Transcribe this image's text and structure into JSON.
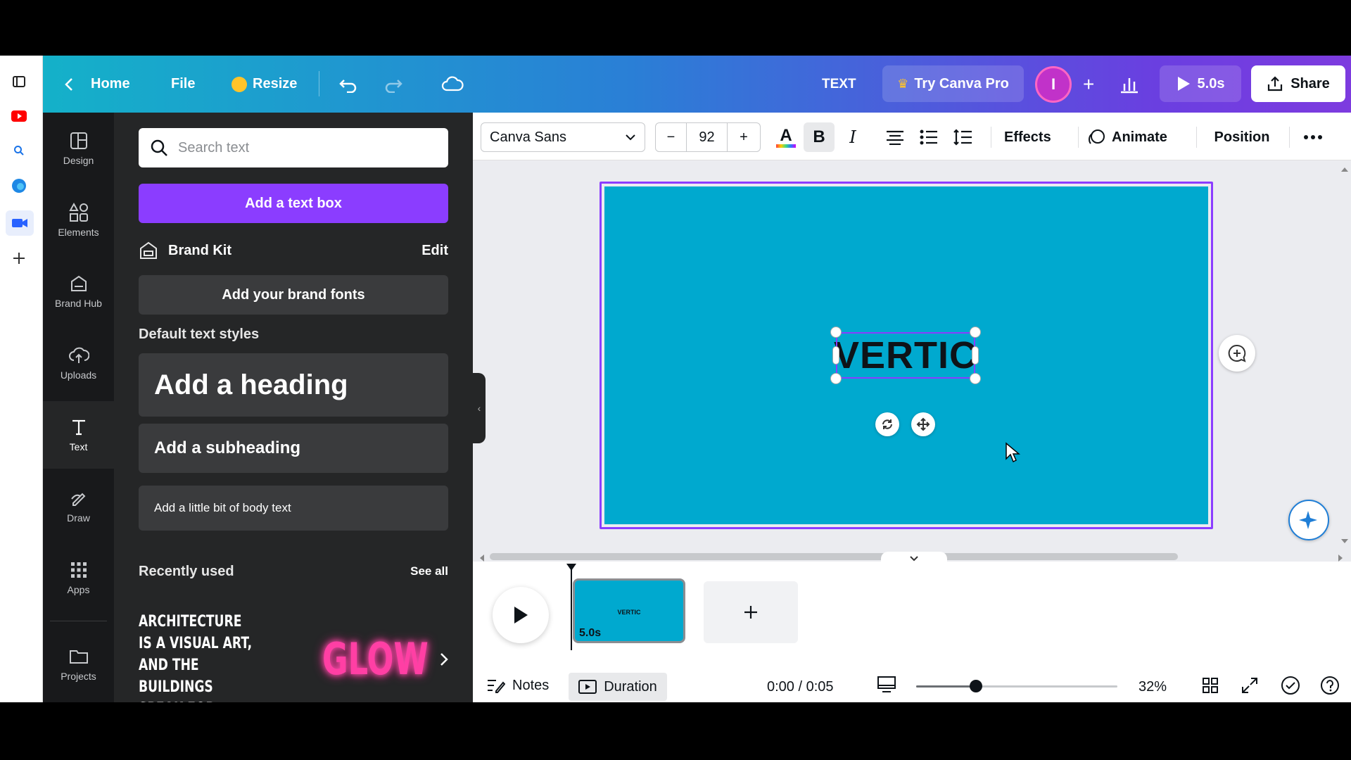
{
  "topbar": {
    "home": "Home",
    "file": "File",
    "resize": "Resize",
    "context_label": "TEXT",
    "try_pro": "Try Canva Pro",
    "avatar_initial": "I",
    "play_duration": "5.0s",
    "share": "Share"
  },
  "rail": {
    "items": [
      {
        "label": "Design",
        "icon": "layout-icon"
      },
      {
        "label": "Elements",
        "icon": "shapes-icon"
      },
      {
        "label": "Brand Hub",
        "icon": "brand-icon"
      },
      {
        "label": "Uploads",
        "icon": "cloud-upload-icon"
      },
      {
        "label": "Text",
        "icon": "text-icon"
      },
      {
        "label": "Draw",
        "icon": "pen-icon"
      },
      {
        "label": "Apps",
        "icon": "grid-icon"
      },
      {
        "label": "Projects",
        "icon": "folder-icon"
      }
    ]
  },
  "panel": {
    "search_placeholder": "Search text",
    "add_text_box": "Add a text box",
    "brand_kit": "Brand Kit",
    "edit": "Edit",
    "add_brand_fonts": "Add your brand fonts",
    "default_styles_title": "Default text styles",
    "heading": "Add a heading",
    "subheading": "Add a subheading",
    "body": "Add a little bit of body text",
    "recently_used": "Recently used",
    "see_all": "See all",
    "recent_1": "ARCHITECTURE IS A VISUAL ART, AND THE BUILDINGS SPEAK FOR THEMSELVES.",
    "recent_2": "GLOW"
  },
  "toolbar": {
    "font": "Canva Sans",
    "minus": "−",
    "size": "92",
    "plus": "+",
    "effects": "Effects",
    "animate": "Animate",
    "position": "Position"
  },
  "canvas": {
    "text": "VERTIC",
    "background_color": "#00a9cf"
  },
  "timeline": {
    "page_text": "VERTIC",
    "page_duration": "5.0s",
    "notes": "Notes",
    "duration": "Duration",
    "time": "0:00 / 0:05",
    "zoom": "32%"
  }
}
